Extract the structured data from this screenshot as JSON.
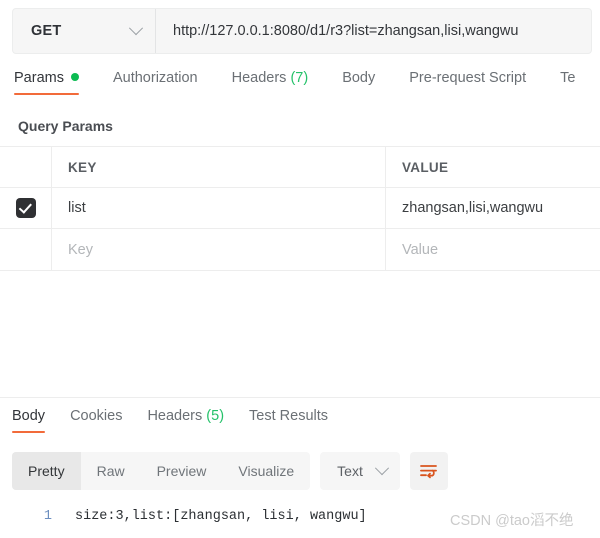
{
  "request": {
    "method": "GET",
    "method_icon": "chevron-down-icon",
    "url": "http://127.0.0.1:8080/d1/r3?list=zhangsan,lisi,wangwu",
    "url_placeholder": "Enter request URL",
    "tabs": [
      {
        "label": "Params",
        "active": true,
        "dot": true
      },
      {
        "label": "Authorization",
        "active": false
      },
      {
        "label": "Headers",
        "count": "(7)",
        "active": false
      },
      {
        "label": "Body",
        "active": false
      },
      {
        "label": "Pre-request Script",
        "active": false
      },
      {
        "label": "Te",
        "active": false
      }
    ]
  },
  "query_params": {
    "section_title": "Query Params",
    "columns": {
      "key": "KEY",
      "value": "VALUE"
    },
    "rows": [
      {
        "checked": true,
        "key": "list",
        "value": "zhangsan,lisi,wangwu",
        "key_placeholder": "Key",
        "value_placeholder": "Value"
      },
      {
        "checked": false,
        "key": "",
        "value": "",
        "key_placeholder": "Key",
        "value_placeholder": "Value"
      }
    ]
  },
  "response": {
    "tabs": [
      {
        "label": "Body",
        "active": true
      },
      {
        "label": "Cookies",
        "active": false
      },
      {
        "label": "Headers",
        "count": "(5)",
        "active": false
      },
      {
        "label": "Test Results",
        "active": false
      }
    ],
    "view_modes": [
      {
        "label": "Pretty",
        "active": true
      },
      {
        "label": "Raw",
        "active": false
      },
      {
        "label": "Preview",
        "active": false
      },
      {
        "label": "Visualize",
        "active": false
      }
    ],
    "format": {
      "selected": "Text",
      "icon": "chevron-down-icon"
    },
    "wrap_button_icon": "word-wrap-icon",
    "body_lines": [
      {
        "number": "1",
        "text": "size:3,list:[zhangsan, lisi, wangwu]"
      }
    ]
  },
  "watermark": "CSDN @tao滔不绝",
  "colors": {
    "accent": "#f26b3a",
    "green": "#0cbb52",
    "count_green": "#25c26a",
    "checkbox": "#2f3033"
  }
}
